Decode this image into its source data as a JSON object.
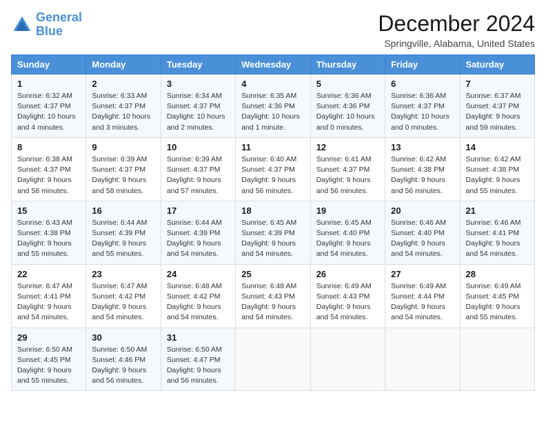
{
  "logo": {
    "line1": "General",
    "line2": "Blue"
  },
  "title": "December 2024",
  "location": "Springville, Alabama, United States",
  "weekdays": [
    "Sunday",
    "Monday",
    "Tuesday",
    "Wednesday",
    "Thursday",
    "Friday",
    "Saturday"
  ],
  "weeks": [
    [
      {
        "day": "1",
        "sunrise": "6:32 AM",
        "sunset": "4:37 PM",
        "daylight": "10 hours and 4 minutes."
      },
      {
        "day": "2",
        "sunrise": "6:33 AM",
        "sunset": "4:37 PM",
        "daylight": "10 hours and 3 minutes."
      },
      {
        "day": "3",
        "sunrise": "6:34 AM",
        "sunset": "4:37 PM",
        "daylight": "10 hours and 2 minutes."
      },
      {
        "day": "4",
        "sunrise": "6:35 AM",
        "sunset": "4:36 PM",
        "daylight": "10 hours and 1 minute."
      },
      {
        "day": "5",
        "sunrise": "6:36 AM",
        "sunset": "4:36 PM",
        "daylight": "10 hours and 0 minutes."
      },
      {
        "day": "6",
        "sunrise": "6:36 AM",
        "sunset": "4:37 PM",
        "daylight": "10 hours and 0 minutes."
      },
      {
        "day": "7",
        "sunrise": "6:37 AM",
        "sunset": "4:37 PM",
        "daylight": "9 hours and 59 minutes."
      }
    ],
    [
      {
        "day": "8",
        "sunrise": "6:38 AM",
        "sunset": "4:37 PM",
        "daylight": "9 hours and 58 minutes."
      },
      {
        "day": "9",
        "sunrise": "6:39 AM",
        "sunset": "4:37 PM",
        "daylight": "9 hours and 58 minutes."
      },
      {
        "day": "10",
        "sunrise": "6:39 AM",
        "sunset": "4:37 PM",
        "daylight": "9 hours and 57 minutes."
      },
      {
        "day": "11",
        "sunrise": "6:40 AM",
        "sunset": "4:37 PM",
        "daylight": "9 hours and 56 minutes."
      },
      {
        "day": "12",
        "sunrise": "6:41 AM",
        "sunset": "4:37 PM",
        "daylight": "9 hours and 56 minutes."
      },
      {
        "day": "13",
        "sunrise": "6:42 AM",
        "sunset": "4:38 PM",
        "daylight": "9 hours and 56 minutes."
      },
      {
        "day": "14",
        "sunrise": "6:42 AM",
        "sunset": "4:38 PM",
        "daylight": "9 hours and 55 minutes."
      }
    ],
    [
      {
        "day": "15",
        "sunrise": "6:43 AM",
        "sunset": "4:38 PM",
        "daylight": "9 hours and 55 minutes."
      },
      {
        "day": "16",
        "sunrise": "6:44 AM",
        "sunset": "4:39 PM",
        "daylight": "9 hours and 55 minutes."
      },
      {
        "day": "17",
        "sunrise": "6:44 AM",
        "sunset": "4:39 PM",
        "daylight": "9 hours and 54 minutes."
      },
      {
        "day": "18",
        "sunrise": "6:45 AM",
        "sunset": "4:39 PM",
        "daylight": "9 hours and 54 minutes."
      },
      {
        "day": "19",
        "sunrise": "6:45 AM",
        "sunset": "4:40 PM",
        "daylight": "9 hours and 54 minutes."
      },
      {
        "day": "20",
        "sunrise": "6:46 AM",
        "sunset": "4:40 PM",
        "daylight": "9 hours and 54 minutes."
      },
      {
        "day": "21",
        "sunrise": "6:46 AM",
        "sunset": "4:41 PM",
        "daylight": "9 hours and 54 minutes."
      }
    ],
    [
      {
        "day": "22",
        "sunrise": "6:47 AM",
        "sunset": "4:41 PM",
        "daylight": "9 hours and 54 minutes."
      },
      {
        "day": "23",
        "sunrise": "6:47 AM",
        "sunset": "4:42 PM",
        "daylight": "9 hours and 54 minutes."
      },
      {
        "day": "24",
        "sunrise": "6:48 AM",
        "sunset": "4:42 PM",
        "daylight": "9 hours and 54 minutes."
      },
      {
        "day": "25",
        "sunrise": "6:48 AM",
        "sunset": "4:43 PM",
        "daylight": "9 hours and 54 minutes."
      },
      {
        "day": "26",
        "sunrise": "6:49 AM",
        "sunset": "4:43 PM",
        "daylight": "9 hours and 54 minutes."
      },
      {
        "day": "27",
        "sunrise": "6:49 AM",
        "sunset": "4:44 PM",
        "daylight": "9 hours and 54 minutes."
      },
      {
        "day": "28",
        "sunrise": "6:49 AM",
        "sunset": "4:45 PM",
        "daylight": "9 hours and 55 minutes."
      }
    ],
    [
      {
        "day": "29",
        "sunrise": "6:50 AM",
        "sunset": "4:45 PM",
        "daylight": "9 hours and 55 minutes."
      },
      {
        "day": "30",
        "sunrise": "6:50 AM",
        "sunset": "4:46 PM",
        "daylight": "9 hours and 56 minutes."
      },
      {
        "day": "31",
        "sunrise": "6:50 AM",
        "sunset": "4:47 PM",
        "daylight": "9 hours and 56 minutes."
      },
      null,
      null,
      null,
      null
    ]
  ]
}
